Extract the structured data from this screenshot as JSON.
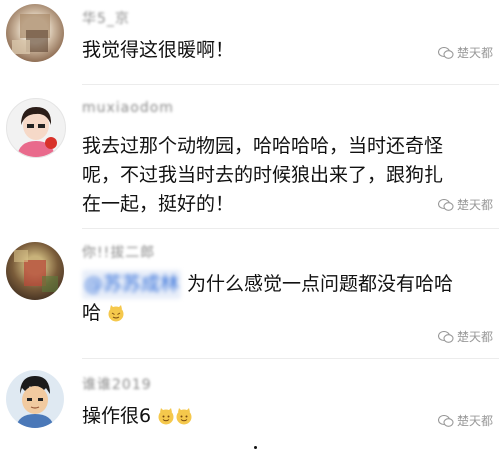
{
  "comments": [
    {
      "name": "华5_京",
      "lines": [
        "我觉得这很暖啊！"
      ],
      "watermark": "楚天都"
    },
    {
      "name": "muxiaodom",
      "lines": [
        "我去过那个动物园，哈哈哈哈，当时还奇怪",
        "呢，不过我当时去的时候狼出来了，跟狗扎",
        "在一起，挺好的！"
      ],
      "watermark": "楚天都"
    },
    {
      "name": "你!!拔二郎",
      "mention": "@苏苏成林",
      "lines": [
        " 为什么感觉一点问题都没有哈哈",
        "哈"
      ],
      "watermark": "楚天都"
    },
    {
      "name": "谁谁2019",
      "lines": [
        "操作很6"
      ],
      "watermark": "楚天都"
    }
  ],
  "icons": {
    "watermark": "wechat-icon",
    "emoji": "cat-face-emoji-icon"
  },
  "colors": {
    "text": "#111111",
    "meta": "#8a8a8a",
    "mention": "#2b6ad8"
  }
}
